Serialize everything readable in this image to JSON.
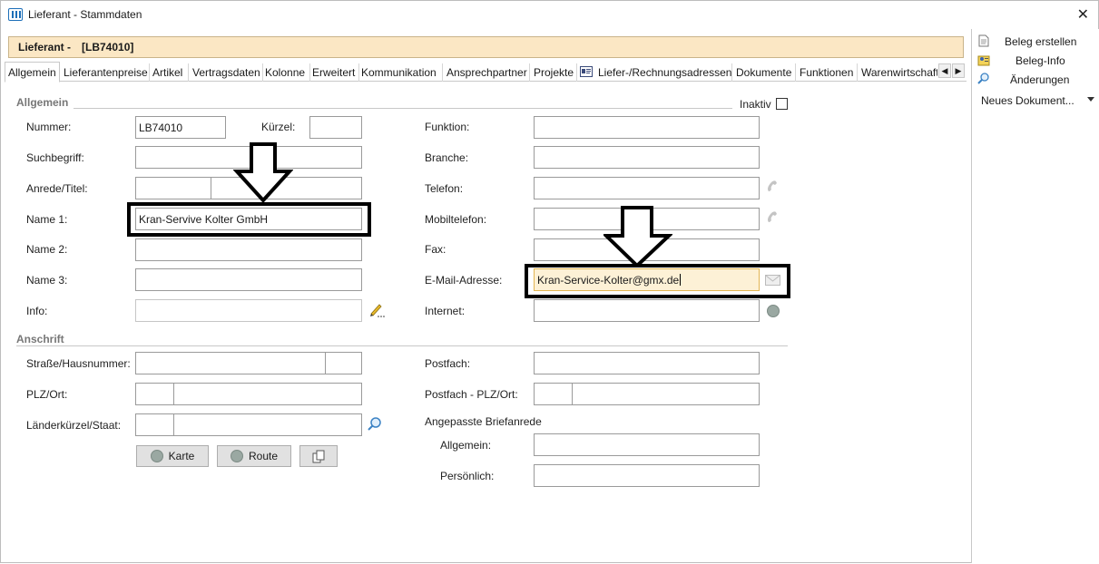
{
  "window": {
    "title": "Lieferant - Stammdaten"
  },
  "header": {
    "label": "Lieferant -",
    "id": "[LB74010]"
  },
  "tabs": [
    "Allgemein",
    "Lieferantenpreise",
    "Artikel",
    "Vertragsdaten",
    "Kolonne",
    "Erweitert",
    "Kommunikation",
    "Ansprechpartner",
    "Projekte",
    "Liefer-/Rechnungsadressen",
    "Dokumente",
    "Funktionen",
    "Warenwirtschaft"
  ],
  "sections": {
    "allgemein": "Allgemein",
    "anschrift": "Anschrift"
  },
  "inaktiv": {
    "label": "Inaktiv",
    "checked": false
  },
  "left_fields": {
    "nummer": {
      "label": "Nummer:",
      "value": "LB74010"
    },
    "kuerzel": {
      "label": "Kürzel:",
      "value": ""
    },
    "suchbegriff": {
      "label": "Suchbegriff:",
      "value": ""
    },
    "anrede": {
      "label": "Anrede/Titel:",
      "value": ""
    },
    "name1": {
      "label": "Name 1:",
      "value": "Kran-Servive Kolter GmbH"
    },
    "name2": {
      "label": "Name 2:",
      "value": ""
    },
    "name3": {
      "label": "Name 3:",
      "value": ""
    },
    "info": {
      "label": "Info:",
      "value": ""
    }
  },
  "right_fields": {
    "funktion": {
      "label": "Funktion:",
      "value": ""
    },
    "branche": {
      "label": "Branche:",
      "value": ""
    },
    "telefon": {
      "label": "Telefon:",
      "value": ""
    },
    "mobil": {
      "label": "Mobiltelefon:",
      "value": ""
    },
    "fax": {
      "label": "Fax:",
      "value": ""
    },
    "email": {
      "label": "E-Mail-Adresse:",
      "value": "Kran-Service-Kolter@gmx.de"
    },
    "internet": {
      "label": "Internet:",
      "value": ""
    }
  },
  "anschrift": {
    "strasse": {
      "label": "Straße/Hausnummer:",
      "value": ""
    },
    "plz": {
      "label": "PLZ/Ort:",
      "value": ""
    },
    "land": {
      "label": "Länderkürzel/Staat:",
      "value": ""
    },
    "postfach": {
      "label": "Postfach:",
      "value": ""
    },
    "postfach_plz": {
      "label": "Postfach - PLZ/Ort:",
      "value": ""
    },
    "briefanrede": {
      "label": "Angepasste Briefanrede"
    },
    "allgemein": {
      "label": "Allgemein:",
      "value": ""
    },
    "persoenlich": {
      "label": "Persönlich:",
      "value": ""
    }
  },
  "buttons": {
    "karte": "Karte",
    "route": "Route"
  },
  "sidebar": {
    "items": [
      "Beleg erstellen",
      "Beleg-Info",
      "Änderungen"
    ],
    "dropdown": "Neues Dokument..."
  },
  "colors": {
    "header_bg": "#fbe7c4",
    "highlight_field": "#fdf1d6",
    "annotation": "#000000"
  }
}
